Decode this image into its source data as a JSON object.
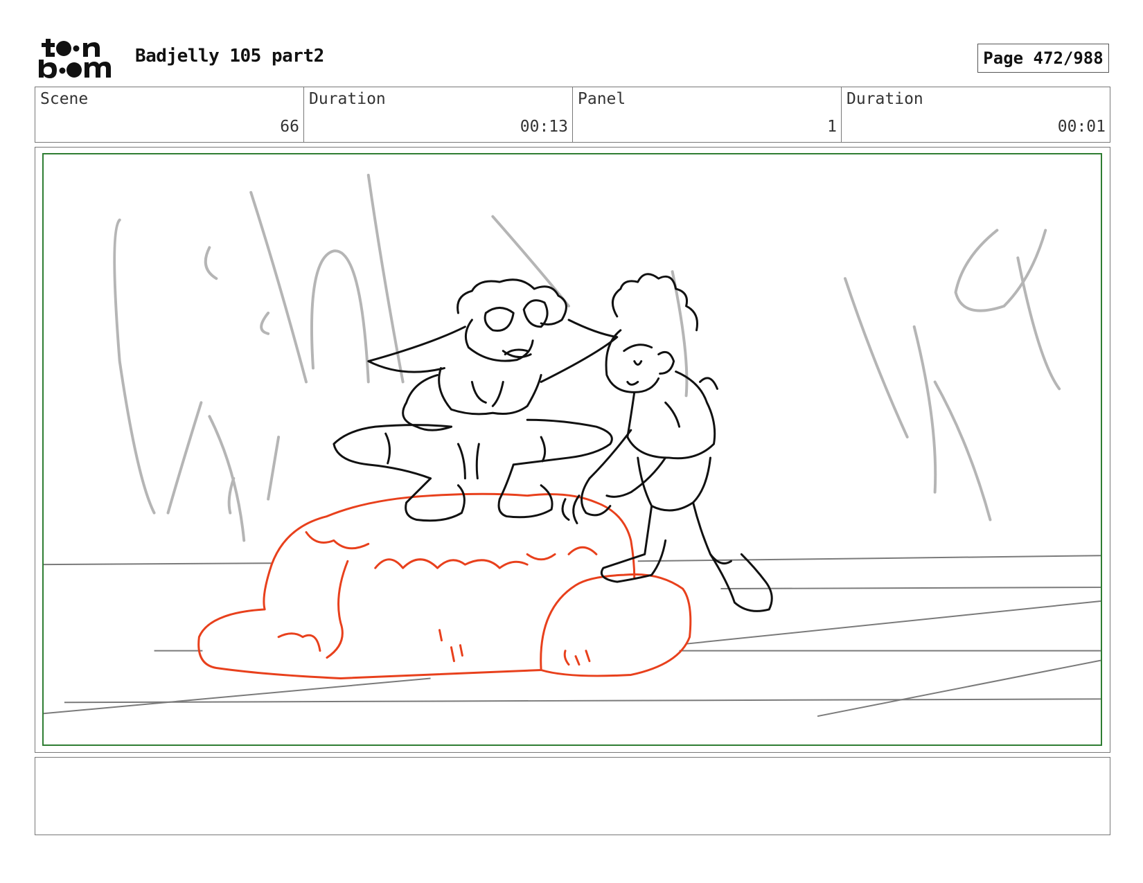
{
  "header": {
    "logo_text": "toon boom",
    "title": "Badjelly 105 part2",
    "page_label": "Page 472/988"
  },
  "info": {
    "scene_label": "Scene",
    "scene_value": "66",
    "scene_duration_label": "Duration",
    "scene_duration_value": "00:13",
    "panel_label": "Panel",
    "panel_value": "1",
    "panel_duration_label": "Duration",
    "panel_duration_value": "00:01"
  },
  "panel": {
    "frame_color": "#2e7d32",
    "sketch_colors": {
      "characters": "#111111",
      "rock": "#e8401c",
      "background": "#b5b5b5",
      "floor": "#7a7a7a"
    }
  },
  "caption": {
    "text": ""
  }
}
